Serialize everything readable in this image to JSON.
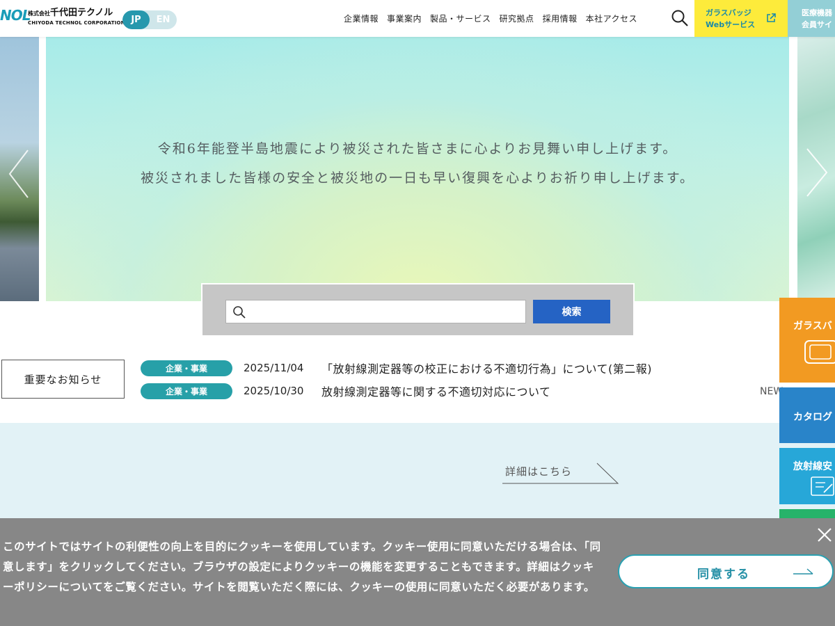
{
  "header": {
    "logo_mark": "NOL",
    "logo_prefix": "株式会社",
    "logo_name_jp": "千代田テクノル",
    "logo_name_en": "CHIYODA TECHNOL CORPORATION",
    "lang": {
      "jp": "JP",
      "en": "EN"
    },
    "nav": [
      "企業情報",
      "事業案内",
      "製品・サービス",
      "研究拠点",
      "採用情報",
      "本社アクセス"
    ],
    "glass_badge": {
      "line1": "ガラスバッジ",
      "line2": "Webサービス"
    },
    "medical": {
      "line1": "医療機器",
      "line2": "会員サイ"
    }
  },
  "hero": {
    "line1": "令和6年能登半島地震により被災された皆さまに心よりお見舞い申し上げます。",
    "line2": "被災されました皆様の安全と被災地の一日も早い復興を心よりお祈り申し上げます。"
  },
  "search": {
    "value": "",
    "button": "検索"
  },
  "notices": {
    "button": "重要なお知らせ",
    "items": [
      {
        "tag": "企業・事業",
        "date": "2025/11/04",
        "title": "「放射線測定器等の校正における不適切行為」について(第二報)"
      },
      {
        "tag": "企業・事業",
        "date": "2025/10/30",
        "title": "放射線測定器等に関する不適切対応について"
      }
    ],
    "news_link": "NEW"
  },
  "band": {
    "detail": "詳細はこちら"
  },
  "side_tabs": {
    "orange": "ガラスバ",
    "blue": "カタログ",
    "sky": "放射線安"
  },
  "cookie": {
    "text": "このサイトではサイトの利便性の向上を目的にクッキーを使用しています。クッキー使用に同意いただける場合は、「同意します」をクリックしてください。ブラウザの設定によりクッキーの機能を変更することもできます。詳細はクッキーポリシーについてをご覧ください。サイトを閲覧いただく際には、クッキーの使用に同意いただく必要があります。",
    "agree": "同意する"
  },
  "colors": {
    "accent": "#27a0a8",
    "search_button": "#2563c4",
    "glass_badge_bg": "#fdeb3b",
    "cookie_bg": "#878787"
  }
}
